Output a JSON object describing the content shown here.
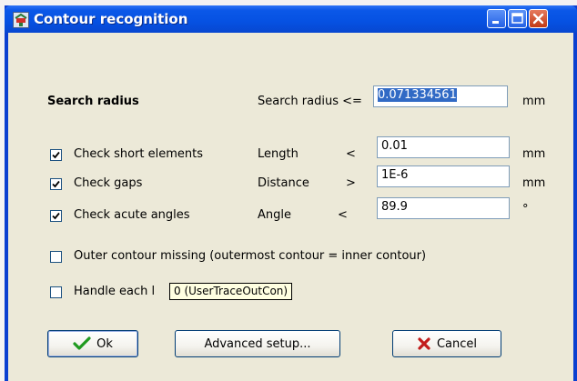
{
  "window": {
    "title": "Contour recognition",
    "icons": {
      "app": "contour-app-icon",
      "minimize": "minimize-icon",
      "maximize": "maximize-icon",
      "close": "close-icon"
    }
  },
  "search": {
    "heading": "Search radius",
    "label": "Search radius <=",
    "value": "0.071334561",
    "unit": "mm"
  },
  "checks": [
    {
      "label": "Check short elements",
      "checked": true,
      "param_label": "Length",
      "operator": "<",
      "value": "0.01",
      "unit": "mm"
    },
    {
      "label": "Check gaps",
      "checked": true,
      "param_label": "Distance",
      "operator": ">",
      "value": "1E-6",
      "unit": "mm"
    },
    {
      "label": "Check acute angles",
      "checked": true,
      "param_label": "Angle",
      "operator": "<",
      "value": "89.9",
      "unit": "°"
    }
  ],
  "options": [
    {
      "label": "Outer contour missing (outermost contour = inner contour)",
      "checked": false
    },
    {
      "label": "Handle each l",
      "checked": false
    }
  ],
  "tooltip": "0 (UserTraceOutCon)",
  "buttons": {
    "ok": "Ok",
    "advanced": "Advanced setup...",
    "cancel": "Cancel"
  },
  "colors": {
    "title_bar": "#0651e2",
    "client": "#ece9d8",
    "selection": "#316ac5",
    "tooltip": "#ffffe1"
  }
}
